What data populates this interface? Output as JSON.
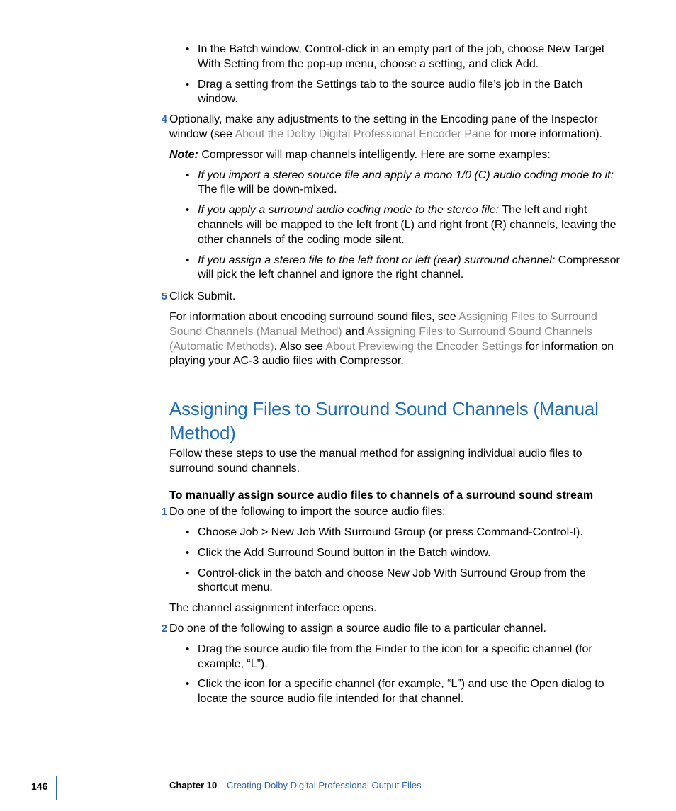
{
  "top_bullets": [
    "In the Batch window, Control-click in an empty part of the job, choose New Target With Setting from the pop-up menu, choose a setting, and click Add.",
    "Drag a setting from the Settings tab to the source audio file’s job in the Batch window."
  ],
  "step4": {
    "num": "4",
    "text_a": "Optionally, make any adjustments to the setting in the Encoding pane of the Inspector window (see ",
    "link": "About the Dolby Digital Professional Encoder Pane",
    "text_b": " for more information).",
    "note_label": "Note:",
    "note_text": "  Compressor will map channels intelligently. Here are some examples:",
    "examples": [
      {
        "lead": "If you import a stereo source file and apply a mono 1/0 (C) audio coding mode to it:",
        "rest": "  The file will be down-mixed."
      },
      {
        "lead": "If you apply a surround audio coding mode to the stereo file:",
        "rest": "  The left and right channels will be mapped to the left front (L) and right front (R) channels, leaving the other channels of the coding mode silent."
      },
      {
        "lead": "If you assign a stereo file to the left front or left (rear) surround channel:",
        "rest": "  Compressor will pick the left channel and ignore the right channel."
      }
    ]
  },
  "step5": {
    "num": "5",
    "line1": "Click Submit.",
    "p2_a": "For information about encoding surround sound files, see ",
    "p2_link1": "Assigning Files to Surround Sound Channels (Manual Method)",
    "p2_b": " and ",
    "p2_link2": "Assigning Files to Surround Sound Channels (Automatic Methods)",
    "p2_c": ". Also see ",
    "p2_link3": "About Previewing the Encoder Settings",
    "p2_d": " for information on playing your AC-3 audio files with Compressor."
  },
  "section": {
    "title": "Assigning Files to Surround Sound Channels (Manual Method)",
    "intro": "Follow these steps to use the manual method for assigning individual audio files to surround sound channels.",
    "task_title": "To manually assign source audio files to channels of a surround sound stream",
    "s1": {
      "num": "1",
      "text": "Do one of the following to import the source audio files:",
      "bullets": [
        "Choose Job > New Job With Surround Group (or press Command-Control-I).",
        "Click the Add Surround Sound button in the Batch window.",
        "Control-click in the batch and choose New Job With Surround Group from the shortcut menu."
      ],
      "after": "The channel assignment interface opens."
    },
    "s2": {
      "num": "2",
      "text": "Do one of the following to assign a source audio file to a particular channel.",
      "bullets": [
        "Drag the source audio file from the Finder to the icon for a specific channel (for example, “L”).",
        "Click the icon for a specific channel (for example, “L”) and use the Open dialog to locate the source audio file intended for that channel."
      ]
    }
  },
  "footer": {
    "page": "146",
    "chapter_label": "Chapter 10",
    "chapter_title": "Creating Dolby Digital Professional Output Files"
  }
}
